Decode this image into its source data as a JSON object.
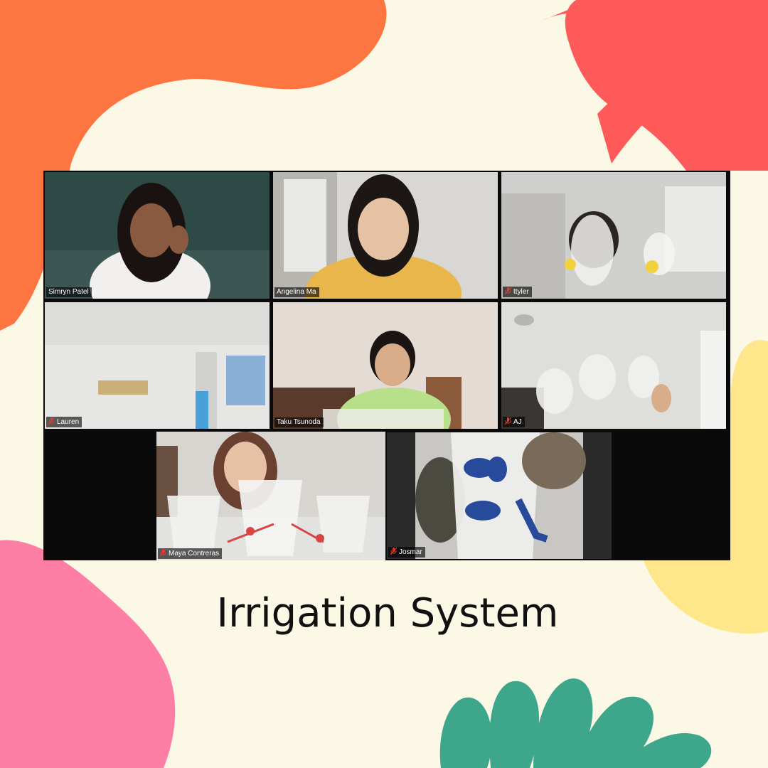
{
  "title": "Irrigation System",
  "colors": {
    "background": "#fbf8e6",
    "orange_blob": "#fd7641",
    "red_leaf": "#fe5a5a",
    "yellow_blob": "#fee68a",
    "pink_blob": "#fd7fa5",
    "teal_leaf": "#3ea78b",
    "active_speaker_border": "#c6e04a"
  },
  "participants": [
    {
      "name": "Simryn Patel",
      "muted": false
    },
    {
      "name": "Angelina Ma",
      "muted": false
    },
    {
      "name": "ttyler",
      "muted": true
    },
    {
      "name": "Lauren",
      "muted": true
    },
    {
      "name": "Taku Tsunoda",
      "muted": false
    },
    {
      "name": "AJ",
      "muted": true
    },
    {
      "name": "Maya Contreras",
      "muted": true,
      "active_speaker": true
    },
    {
      "name": "Josmar",
      "muted": true
    }
  ]
}
